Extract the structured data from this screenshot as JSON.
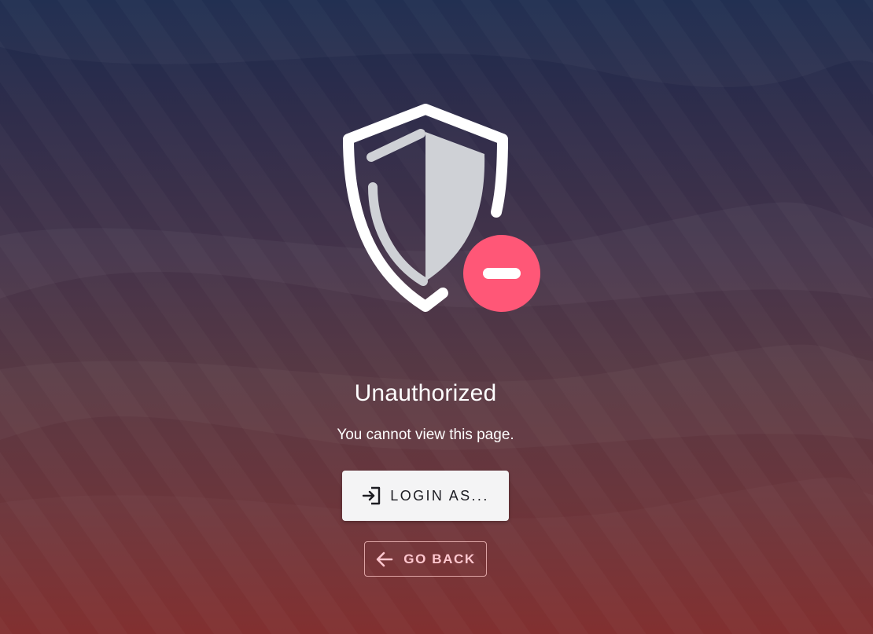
{
  "error": {
    "title": "Unauthorized",
    "message": "You cannot view this page."
  },
  "actions": {
    "login_label": "LOGIN AS...",
    "login_icon": "login-icon",
    "back_label": "GO BACK",
    "back_icon": "arrow-left-icon"
  },
  "illustration": {
    "icon": "shield-blocked-icon",
    "badge_icon": "minus-circle-icon"
  },
  "colors": {
    "badge": "#ff5777",
    "shield_fill": "#cfd1d6",
    "back_text": "#ffc7cf",
    "login_bg": "#f4f4f5"
  }
}
